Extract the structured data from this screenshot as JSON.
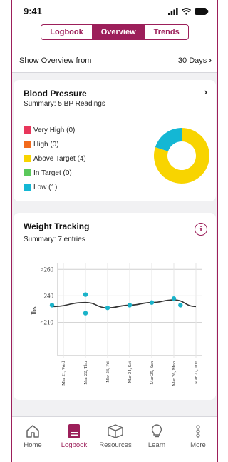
{
  "status": {
    "time": "9:41"
  },
  "segments": [
    {
      "label": "Logbook",
      "active": false
    },
    {
      "label": "Overview",
      "active": true
    },
    {
      "label": "Trends",
      "active": false
    }
  ],
  "show_from": {
    "label": "Show Overview from",
    "value": "30 Days"
  },
  "blood_pressure": {
    "title": "Blood Pressure",
    "summary": "Summary: 5 BP Readings",
    "legend": [
      {
        "label": "Very High (0)",
        "color": "#e8365b",
        "count": 0
      },
      {
        "label": "High (0)",
        "color": "#f26a1b",
        "count": 0
      },
      {
        "label": "Above Target (4)",
        "color": "#f8d400",
        "count": 4
      },
      {
        "label": "In Target (0)",
        "color": "#5ac85a",
        "count": 0
      },
      {
        "label": "Low (1)",
        "color": "#14b7d4",
        "count": 1
      }
    ]
  },
  "weight": {
    "title": "Weight Tracking",
    "summary": "Summary: 7 entries",
    "info_icon": "info-icon"
  },
  "chart_data": {
    "type": "line",
    "ylabel": "lbs",
    "y_ticks": [
      ">260",
      "240",
      "<210"
    ],
    "categories": [
      "Mar 21, Wed",
      "Mar 22, Thu",
      "Mar 23, Fri",
      "Mar 24, Sat",
      "Mar 25, Sun",
      "Mar 26, Mon",
      "Mar 27, Tue"
    ],
    "points": [
      {
        "x": 0,
        "y": 233
      },
      {
        "x": 1,
        "y": 241
      },
      {
        "x": 1,
        "y": 227
      },
      {
        "x": 2,
        "y": 231
      },
      {
        "x": 3,
        "y": 233
      },
      {
        "x": 4,
        "y": 235
      },
      {
        "x": 5,
        "y": 238
      },
      {
        "x": 5.3,
        "y": 233
      }
    ],
    "trend": [
      232,
      235,
      231,
      233,
      235,
      237,
      232
    ],
    "point_color": "#1bb3c9",
    "line_color": "#333333"
  },
  "tabs": [
    {
      "label": "Home",
      "icon": "home-icon",
      "active": false
    },
    {
      "label": "Logbook",
      "icon": "logbook-icon",
      "active": true
    },
    {
      "label": "Resources",
      "icon": "resources-icon",
      "active": false
    },
    {
      "label": "Learn",
      "icon": "lightbulb-icon",
      "active": false
    },
    {
      "label": "More",
      "icon": "more-icon",
      "active": false
    }
  ]
}
